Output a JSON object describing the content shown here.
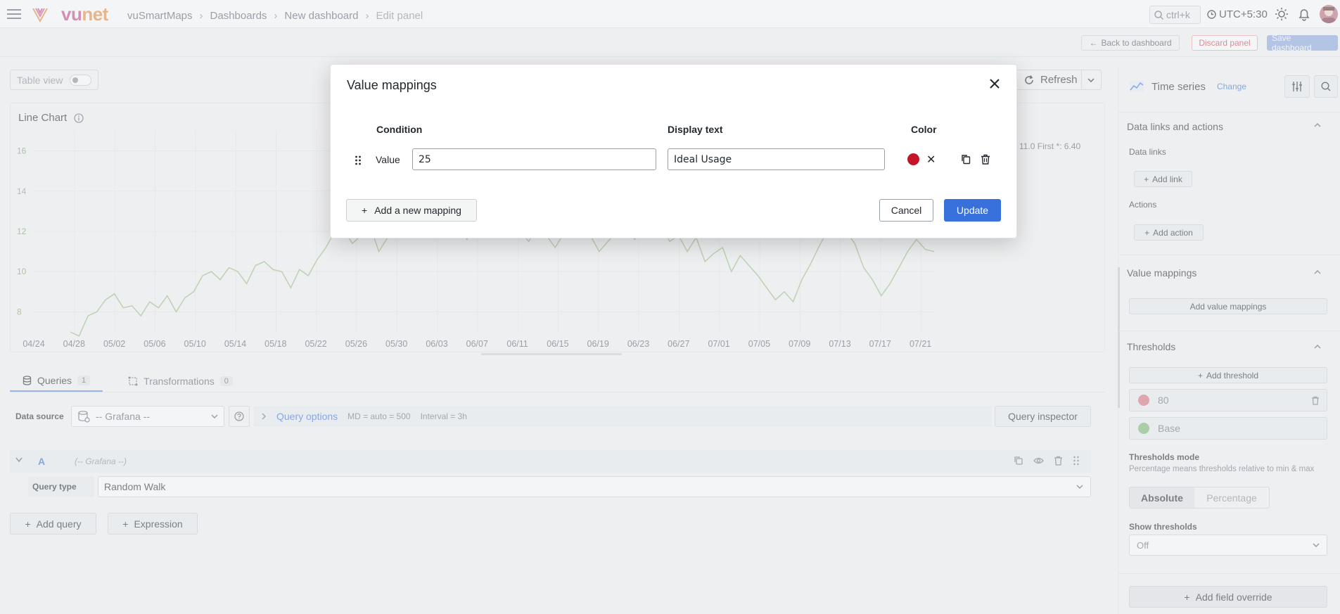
{
  "topbar": {
    "logo_main": "vu",
    "logo_accent": "net",
    "breadcrumbs": [
      "vuSmartMaps",
      "Dashboards",
      "New dashboard",
      "Edit panel"
    ],
    "search_placeholder": "ctrl+k",
    "timezone": "UTC+5:30"
  },
  "actionbar": {
    "back_label": "Back to dashboard",
    "discard_label": "Discard panel",
    "save_label": "Save dashboard"
  },
  "panel": {
    "table_view_label": "Table view",
    "refresh_label": "Refresh",
    "title": "Line Chart",
    "legend_stats": "11.0   First *: 6.40"
  },
  "chart_data": {
    "type": "line",
    "series": [
      {
        "values": [
          7.0,
          6.8,
          7.8,
          8.0,
          8.6,
          8.9,
          8.2,
          8.3,
          7.8,
          8.5,
          8.2,
          8.8,
          8.0,
          8.7,
          9.0,
          9.8,
          10.0,
          9.6,
          10.2,
          10.0,
          9.4,
          10.3,
          10.5,
          10.1,
          10.0,
          9.2,
          10.1,
          9.8,
          10.6,
          11.2,
          12.0,
          12.1,
          11.4,
          11.8,
          12.3,
          11.0,
          11.7,
          12.0,
          12.4,
          11.8,
          12.6,
          12.9,
          12.0,
          12.5,
          12.2,
          11.6,
          12.8,
          12.3,
          12.0,
          11.8,
          12.4,
          12.0,
          11.5,
          12.2,
          11.8,
          11.2,
          11.9,
          12.0,
          12.2,
          11.8,
          11.0,
          11.5,
          12.0,
          12.4,
          11.6,
          12.0,
          11.8,
          12.3,
          11.5,
          11.8,
          11.0,
          11.7,
          10.5,
          10.9,
          11.2,
          10.0,
          10.8,
          10.3,
          9.8,
          9.2,
          8.6,
          9.0,
          8.5,
          9.6,
          10.4,
          11.3,
          12.1,
          12.5,
          12.0,
          11.4,
          10.2,
          9.6,
          8.8,
          9.4,
          10.2,
          11.0,
          11.6,
          11.1,
          11.0
        ]
      }
    ],
    "x_ticks": [
      "04/24",
      "04/28",
      "05/02",
      "05/06",
      "05/10",
      "05/14",
      "05/18",
      "05/22",
      "05/26",
      "05/30",
      "06/03",
      "06/07",
      "06/11",
      "06/15",
      "06/19",
      "06/23",
      "06/27",
      "07/01",
      "07/05",
      "07/09",
      "07/13",
      "07/17",
      "07/21"
    ],
    "y_ticks": [
      "16",
      "14",
      "12",
      "10",
      "8"
    ],
    "ylim": [
      7,
      17
    ],
    "grid": true,
    "line_color": "#9bbe89"
  },
  "queries": {
    "tab_queries": "Queries",
    "tab_queries_count": "1",
    "tab_transformations": "Transformations",
    "tab_transformations_count": "0",
    "datasource_label": "Data source",
    "datasource_value": "-- Grafana --",
    "query_options_label": "Query options",
    "md_text": "MD = auto = 500",
    "interval_text": "Interval = 3h",
    "inspector_label": "Query inspector",
    "query_letter": "A",
    "query_ds": "(-- Grafana --)",
    "query_type_label": "Query type",
    "query_type_value": "Random Walk",
    "add_query_label": "Add query",
    "expression_label": "Expression"
  },
  "sidebar": {
    "viz_name": "Time series",
    "change_label": "Change",
    "data_links_title": "Data links and actions",
    "data_links_sub": "Data links",
    "add_link": "Add link",
    "actions_sub": "Actions",
    "add_action": "Add action",
    "value_mappings_title": "Value mappings",
    "add_value_mappings": "Add value mappings",
    "thresholds_title": "Thresholds",
    "add_threshold": "Add threshold",
    "threshold_1": "80",
    "threshold_1_color": "#d9707d",
    "threshold_base": "Base",
    "threshold_base_color": "#7bb873",
    "thresholds_mode_label": "Thresholds mode",
    "thresholds_mode_desc": "Percentage means thresholds relative to min & max",
    "mode_absolute": "Absolute",
    "mode_percentage": "Percentage",
    "show_thresholds_label": "Show thresholds",
    "show_thresholds_value": "Off",
    "add_field_override": "Add field override"
  },
  "modal": {
    "title": "Value mappings",
    "col_condition": "Condition",
    "col_display": "Display text",
    "col_color": "Color",
    "row_type": "Value",
    "row_value": "25",
    "row_display": "Ideal Usage",
    "row_color": "#c4162a",
    "add_mapping": "Add a new mapping",
    "cancel": "Cancel",
    "update": "Update"
  }
}
